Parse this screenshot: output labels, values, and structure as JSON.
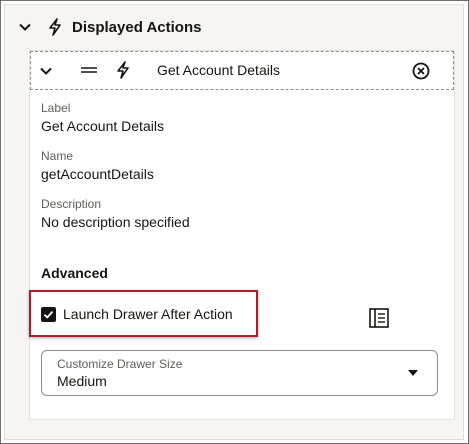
{
  "section": {
    "title": "Displayed Actions"
  },
  "action": {
    "title": "Get Account Details",
    "fields": [
      {
        "label": "Label",
        "value": "Get Account Details"
      },
      {
        "label": "Name",
        "value": "getAccountDetails"
      },
      {
        "label": "Description",
        "value": "No description specified"
      }
    ]
  },
  "advanced": {
    "title": "Advanced",
    "launch_drawer_label": "Launch Drawer After Action",
    "launch_drawer_checked": true,
    "drawer_size": {
      "label": "Customize Drawer Size",
      "value": "Medium"
    }
  },
  "colors": {
    "highlight": "#b01c2e",
    "text": "#161513",
    "muted": "#5f5e5c"
  },
  "icons": [
    "chevron-down-icon",
    "lightning-icon",
    "drag-handle-icon",
    "close-circle-icon",
    "checkmark-icon",
    "drawer-icon",
    "caret-down-icon"
  ]
}
